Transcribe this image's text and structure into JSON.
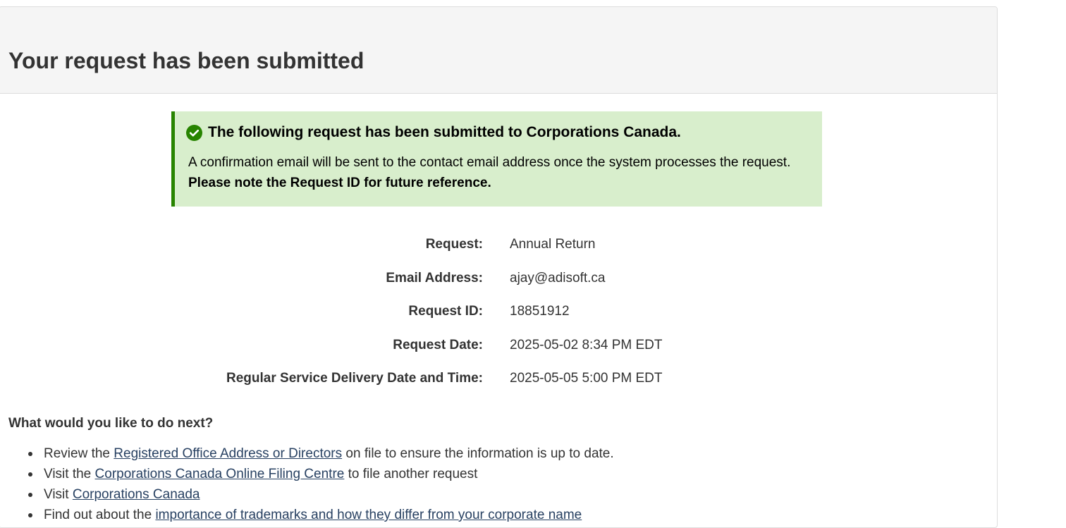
{
  "header": {
    "title": "Your request has been submitted"
  },
  "alert": {
    "icon": "check-circle-icon",
    "color": "#278400",
    "background": "#d8eecc",
    "heading": "The following request has been submitted to Corporations Canada.",
    "body_text": "A confirmation email will be sent to the contact email address once the system processes the request.",
    "body_bold": "Please note the Request ID for future reference."
  },
  "details": [
    {
      "label": "Request:",
      "value": "Annual Return"
    },
    {
      "label": "Email Address:",
      "value": "ajay@adisoft.ca"
    },
    {
      "label": "Request ID:",
      "value": "18851912"
    },
    {
      "label": "Request Date:",
      "value": "2025-05-02 8:34 PM EDT"
    },
    {
      "label": "Regular Service Delivery Date and Time:",
      "value": "2025-05-05 5:00 PM EDT"
    }
  ],
  "next_steps": {
    "heading": "What would you like to do next?",
    "items": [
      {
        "before": "Review the ",
        "link": "Registered Office Address or Directors",
        "after": " on file to ensure the information is up to date."
      },
      {
        "before": "Visit the ",
        "link": "Corporations Canada Online Filing Centre",
        "after": " to file another request"
      },
      {
        "before": "Visit ",
        "link": "Corporations Canada",
        "after": ""
      },
      {
        "before": "Find out about the ",
        "link": "importance of trademarks and how they differ from your corporate name",
        "after": ""
      }
    ]
  },
  "colors": {
    "link": "#284162",
    "heading_bg": "#f5f5f5"
  }
}
